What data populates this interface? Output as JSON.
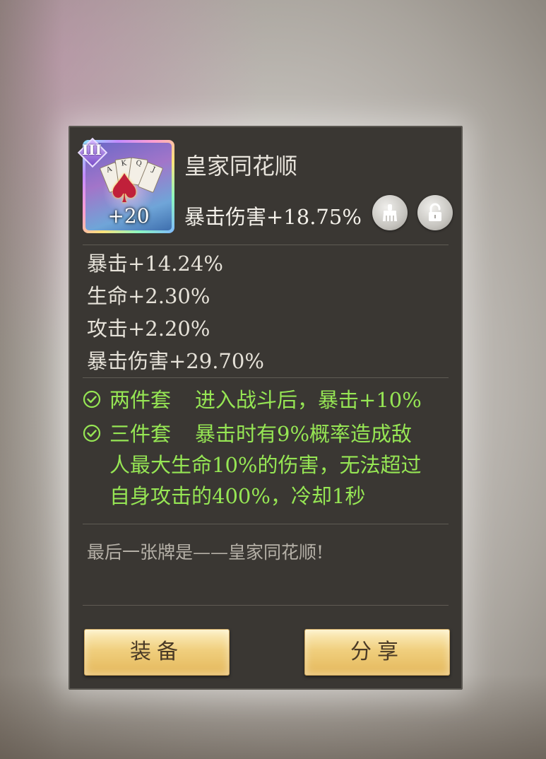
{
  "item": {
    "tier": "III",
    "level": "+20",
    "name": "皇家同花顺",
    "main_stat": "暴击伤害+18.75%"
  },
  "icons": {
    "clean": "broom-icon",
    "lock": "unlocked-padlock-icon"
  },
  "sub_stats": [
    "暴击+14.24%",
    "生命+2.30%",
    "攻击+2.20%",
    "暴击伤害+29.70%"
  ],
  "set_effects": [
    {
      "name": "两件套",
      "lines": [
        "进入战斗后，暴击+10%"
      ]
    },
    {
      "name": "三件套",
      "lines": [
        "暴击时有9%概率造成敌",
        "人最大生命10%的伤害，无法超过",
        "自身攻击的400%，冷却1秒"
      ]
    }
  ],
  "flavor_text": "最后一张牌是——皇家同花顺!",
  "buttons": {
    "equip": "装备",
    "share": "分享"
  },
  "colors": {
    "set_effect_green": "#96e654",
    "panel_bg": "#3a3733",
    "button_gold": "#f0cf7e"
  }
}
